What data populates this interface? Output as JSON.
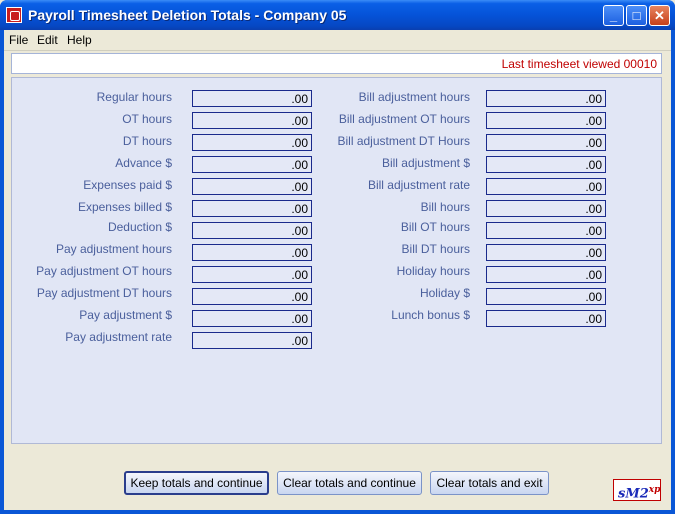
{
  "window": {
    "title": "Payroll Timesheet Deletion Totals  -  Company 05",
    "minimize": "_",
    "maximize": "□",
    "close": "✕"
  },
  "menu": {
    "file": "File",
    "edit": "Edit",
    "help": "Help"
  },
  "status": {
    "last_viewed": "Last timesheet viewed  00010"
  },
  "left_fields": [
    {
      "label": "Regular hours",
      "value": ".00"
    },
    {
      "label": "OT hours",
      "value": ".00"
    },
    {
      "label": "DT hours",
      "value": ".00"
    },
    {
      "label": "Advance $",
      "value": ".00"
    },
    {
      "label": "Expenses paid $",
      "value": ".00"
    },
    {
      "label": "Expenses billed $",
      "value": ".00"
    },
    {
      "label": "Deduction $",
      "value": ".00"
    },
    {
      "label": "Pay adjustment hours",
      "value": ".00"
    },
    {
      "label": "Pay adjustment OT hours",
      "value": ".00"
    },
    {
      "label": "Pay adjustment DT hours",
      "value": ".00"
    },
    {
      "label": "Pay adjustment $",
      "value": ".00"
    },
    {
      "label": "Pay adjustment rate",
      "value": ".00"
    }
  ],
  "right_fields": [
    {
      "label": "Bill adjustment hours",
      "value": ".00"
    },
    {
      "label": "Bill adjustment OT hours",
      "value": ".00"
    },
    {
      "label": "Bill adjustment DT Hours",
      "value": ".00"
    },
    {
      "label": "Bill adjustment $",
      "value": ".00"
    },
    {
      "label": "Bill adjustment rate",
      "value": ".00"
    },
    {
      "label": "Bill hours",
      "value": ".00"
    },
    {
      "label": "Bill OT hours",
      "value": ".00"
    },
    {
      "label": "Bill DT hours",
      "value": ".00"
    },
    {
      "label": "Holiday hours",
      "value": ".00"
    },
    {
      "label": "Holiday $",
      "value": ".00"
    },
    {
      "label": "Lunch bonus $",
      "value": ".00"
    }
  ],
  "buttons": {
    "keep": "Keep totals and continue",
    "clear_continue": "Clear totals and continue",
    "clear_exit": "Clear totals and exit"
  },
  "logo": {
    "main": "sM2",
    "sup": "xp"
  }
}
